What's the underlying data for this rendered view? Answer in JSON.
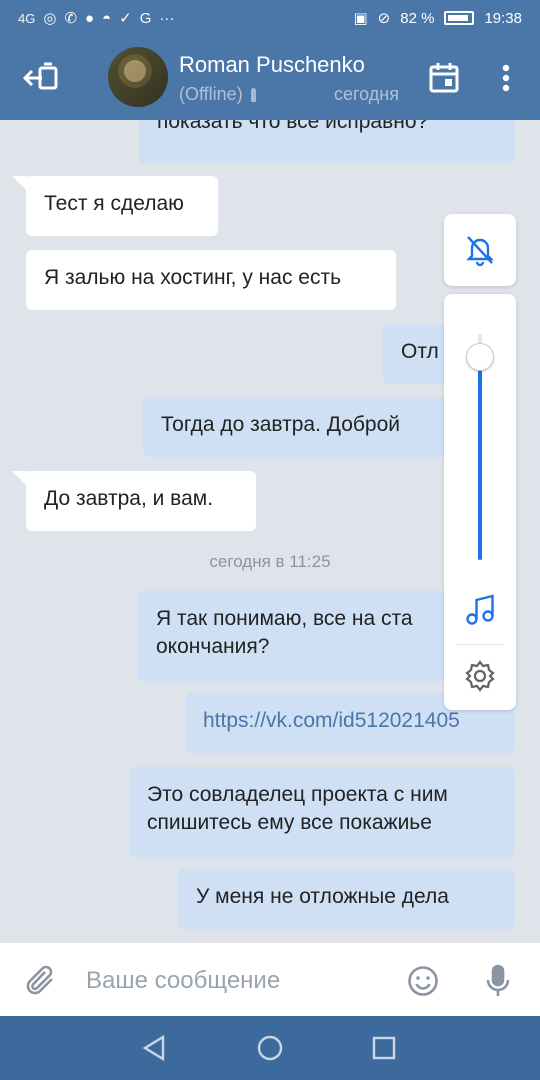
{
  "status_bar": {
    "network": "4G",
    "battery_percent": "82 %",
    "time": "19:38",
    "icons": [
      "hotspot-icon",
      "whatsapp-icon",
      "messages-icon",
      "discord-icon",
      "vk-icon",
      "google-icon",
      "more-dots-icon",
      "nfc-icon",
      "mute-icon"
    ]
  },
  "header": {
    "contact_name": "Roman Puschenko",
    "presence": "(Offline)",
    "last_seen": "сегодня"
  },
  "messages": [
    {
      "dir": "out",
      "text": "показать что все исправно?"
    },
    {
      "dir": "in",
      "text": "Тест я сделаю"
    },
    {
      "dir": "in",
      "text": "Я залью на хостинг, у нас есть"
    },
    {
      "dir": "out",
      "text": "Отл"
    },
    {
      "dir": "out",
      "text": "Тогда до завтра. Доброй"
    },
    {
      "dir": "in",
      "text": "До завтра, и вам."
    },
    {
      "dir": "out",
      "text": "Я так понимаю, все на ста"
    },
    {
      "dir": "out",
      "text": "окончания?"
    },
    {
      "dir": "out",
      "text": "https://vk.com/id512021405"
    },
    {
      "dir": "out",
      "text": "Это совладелец проекта с ним"
    },
    {
      "dir": "out",
      "text": "спишитесь ему все покажиье"
    },
    {
      "dir": "out",
      "text": "У меня не отложные дела"
    }
  ],
  "date_separator": "сегодня в 11:25",
  "volume_overlay": {
    "level": 0.9,
    "accent": "#1a73e8"
  },
  "composer": {
    "placeholder": "Ваше сообщение"
  },
  "colors": {
    "brand": "#4a76a8",
    "chat_bg": "#dfe4ea",
    "outgoing_bubble": "#cfe0f5",
    "incoming_bubble": "#ffffff"
  }
}
